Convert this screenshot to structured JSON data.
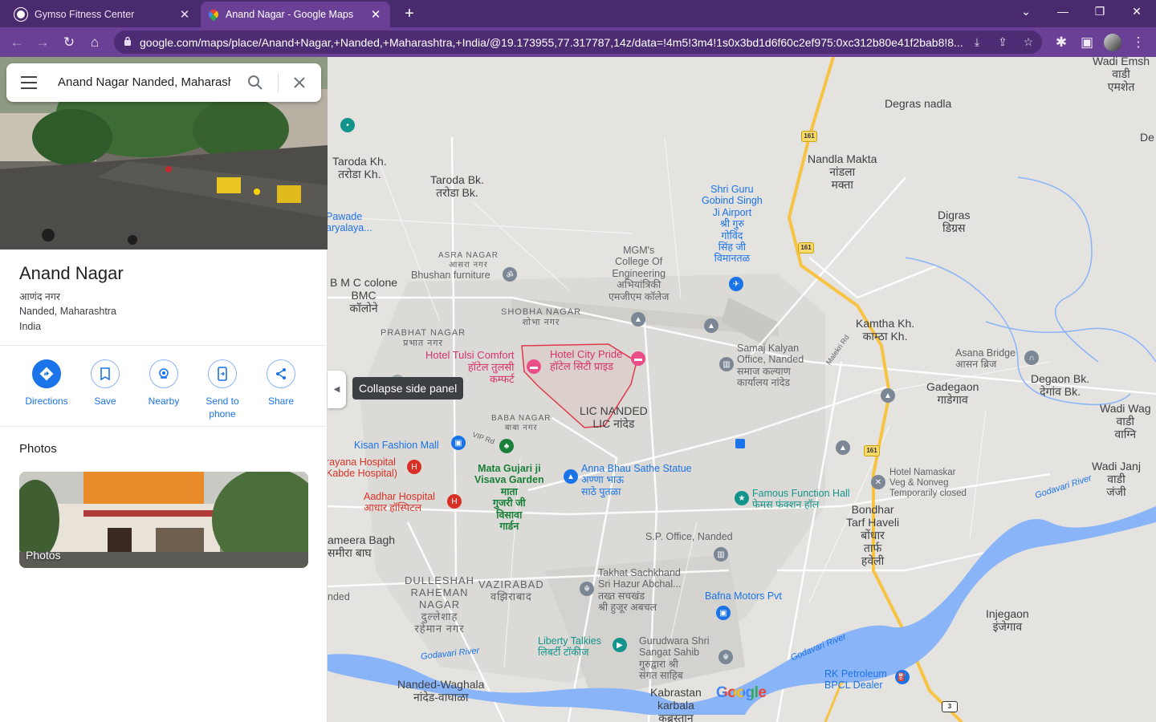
{
  "browser": {
    "tabs": [
      {
        "title": "Gymso Fitness Center",
        "active": false
      },
      {
        "title": "Anand Nagar - Google Maps",
        "active": true
      }
    ],
    "url": "google.com/maps/place/Anand+Nagar,+Nanded,+Maharashtra,+India/@19.173955,77.317787,14z/data=!4m5!3m4!1s0x3bd1d6f60c2ef975:0xc312b80e41f2bab8!8..."
  },
  "search": {
    "query": "Anand Nagar Nanded, Maharashtra"
  },
  "place": {
    "name": "Anand Nagar",
    "name_local": "आणंद नगर",
    "city": "Nanded, Maharashtra",
    "country": "India"
  },
  "actions": [
    {
      "label": "Directions",
      "icon": "directions-icon"
    },
    {
      "label": "Save",
      "icon": "bookmark-icon"
    },
    {
      "label": "Nearby",
      "icon": "nearby-icon"
    },
    {
      "label": "Send to phone",
      "icon": "send-to-phone-icon"
    },
    {
      "label": "Share",
      "icon": "share-icon"
    }
  ],
  "photos": {
    "heading": "Photos",
    "card_label": "Photos"
  },
  "tooltip": "Collapse side panel",
  "map": {
    "areas": [
      {
        "key": "degras",
        "text": "Degras nadla"
      },
      {
        "key": "wadiemsh",
        "text": "Wadi Emsh\nवाडी\nएमशेत"
      },
      {
        "key": "de",
        "text": "De"
      },
      {
        "key": "nandla",
        "text": "Nandla Makta\nनांडला\nमक्ता"
      },
      {
        "key": "taroda_kh",
        "text": "Taroda Kh.\nतरोडा Kh."
      },
      {
        "key": "taroda_bk",
        "text": "Taroda Bk.\nतरोडा Bk."
      },
      {
        "key": "digras",
        "text": "Digras\nडिग्रस"
      },
      {
        "key": "bmc",
        "text": "B M C colone\nBMC\nकॉलोने"
      },
      {
        "key": "kamtha",
        "text": "Kamtha Kh.\nकाम्ठा Kh."
      },
      {
        "key": "gadegaon",
        "text": "Gadegaon\nगाडेगाव"
      },
      {
        "key": "degaon",
        "text": "Degaon Bk.\nदेगांव Bk."
      },
      {
        "key": "wadiwag",
        "text": "Wadi Wag\nवाडी\nवाग्नि"
      },
      {
        "key": "wadijanj",
        "text": "Wadi Janj\nवाडी\nजंजी"
      },
      {
        "key": "lic",
        "text": "LIC NANDED\nLIC नांदेड"
      },
      {
        "key": "bondhar",
        "text": "Bondhar\nTarf Haveli\nबोंधार\nतार्फ\nहवेली"
      },
      {
        "key": "injegaon",
        "text": "Injegaon\nइंजेगाव"
      },
      {
        "key": "sameera",
        "text": "ameera Bagh\nसमीरा बाघ"
      },
      {
        "key": "nanded_waghala",
        "text": "Nanded-Waghala\nनांदेड-वाघाळा"
      },
      {
        "key": "kabrastan",
        "text": "Kabrastan\nkarbala\nकब्रस्तान"
      },
      {
        "key": "nded",
        "text": "nded"
      }
    ],
    "neighborhoods": [
      {
        "key": "asra",
        "text": "ASRA NAGAR\nआसरा नगर"
      },
      {
        "key": "shobha",
        "text": "SHOBHA NAGAR\nशोभा नगर"
      },
      {
        "key": "prabhat",
        "text": "PRABHAT NAGAR\nप्रभात नगर"
      },
      {
        "key": "baba",
        "text": "BABA NAGAR\nबाबा नगर"
      },
      {
        "key": "dulleshah",
        "text": "DULLESHAH\nRAHEMAN\nNAGAR\nदुल्लेशाह\nरहेमान नगर"
      },
      {
        "key": "vazirabad",
        "text": "VAZIRABAD\nवझिराबाद"
      }
    ],
    "pois": [
      {
        "key": "airport",
        "text": "Shri Guru\nGobind Singh\nJi Airport\nश्री गुरु\nगोविंद\nसिंह जी\nविमानतळ",
        "color": "#1a73e8"
      },
      {
        "key": "mgm",
        "text": "MGM's\nCollege Of\nEngineering\nअभियांत्रिकी\nएमजीएम कॉलेज",
        "color": "#5f6368"
      },
      {
        "key": "pawade",
        "text": "Pawade\naryalaya...",
        "color": "#1a73e8"
      },
      {
        "key": "bhushan",
        "text": "Bhushan furniture",
        "color": "#5f6368"
      },
      {
        "key": "tulsi",
        "text": "Hotel Tulsi Comfort\nहॉटेल तुलसी\nकम्फर्ट",
        "color": "#d6336c"
      },
      {
        "key": "citypride",
        "text": "Hotel City Pride\nहॉटेल सिटी प्राइड",
        "color": "#d6336c"
      },
      {
        "key": "samaj",
        "text": "Samaj Kalyan\nOffice, Nanded\nसमाज कल्याण\nकार्यालय नांदेड",
        "color": "#5f6368"
      },
      {
        "key": "asana",
        "text": "Asana Bridge\nआसन ब्रिज",
        "color": "#5f6368"
      },
      {
        "key": "kisan",
        "text": "Kisan Fashion Mall",
        "color": "#1a73e8"
      },
      {
        "key": "mata",
        "text": "Mata Gujari ji\nVisava Garden\nमाता\nगुजरी जी\nविसावा\nगार्डन",
        "color": "#188038"
      },
      {
        "key": "annabhau",
        "text": "Anna Bhau Sathe Statue\nअण्णा भाऊ\nसाठे पुतळा",
        "color": "#1a73e8"
      },
      {
        "key": "sarayana",
        "text": "rayana Hospital\nKabde Hospital)",
        "color": "#d93025"
      },
      {
        "key": "aadhar",
        "text": "Aadhar Hospital\nआधार हॉस्पिटल",
        "color": "#d93025"
      },
      {
        "key": "famous",
        "text": "Famous Function Hall\nफेमस फंक्शन हॉल",
        "color": "#12948c"
      },
      {
        "key": "namaskar",
        "text": "Hotel Namaskar\nVeg & Nonveg\nTemporarily closed",
        "color": "#5f6368"
      },
      {
        "key": "spoffice",
        "text": "S.P. Office, Nanded",
        "color": "#5f6368"
      },
      {
        "key": "takhat",
        "text": "Takhat Sachkhand\nSri Hazur Abchal...\nतख्त सचखंड\nश्री हुजूर अबचल",
        "color": "#5f6368"
      },
      {
        "key": "bafna",
        "text": "Bafna Motors Pvt",
        "color": "#1a73e8"
      },
      {
        "key": "liberty",
        "text": "Liberty Talkies\nलिबर्टी टॉकीज",
        "color": "#12948c"
      },
      {
        "key": "gurudwara",
        "text": "Gurudwara Shri\nSangat Sahib\nगुरुद्वारा श्री\nसंगत साहिब",
        "color": "#5f6368"
      },
      {
        "key": "rkpetroleum",
        "text": "RK Petroleum\nBPCL Dealer",
        "color": "#1a73e8"
      }
    ],
    "roads": {
      "malekri": "Malekri Rd",
      "vip": "VIP Rd"
    },
    "rivers": [
      "Godavari River",
      "Godavari River",
      "Godavari River"
    ],
    "highways": [
      "161",
      "161",
      "161",
      "3"
    ],
    "logo": "Google",
    "colors": {
      "map_bg": "#e5e3df",
      "water": "#8ab4f8",
      "highway": "#f6c343",
      "boundary": "#e0394b"
    }
  }
}
